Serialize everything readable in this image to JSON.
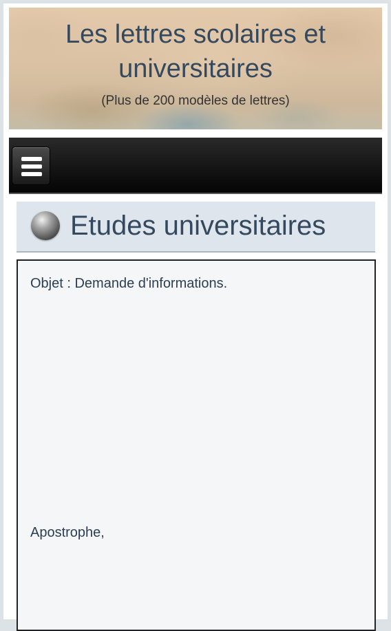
{
  "header": {
    "title": "Les lettres scolaires et universitaires",
    "subtitle": "(Plus de 200 modèles de lettres)"
  },
  "navbar": {
    "menu_icon": "hamburger-menu-icon"
  },
  "section": {
    "bullet_icon": "sphere-bullet-icon",
    "title": "Etudes universitaires"
  },
  "letter": {
    "object_line": "Objet : Demande d'informations.",
    "salutation": "Apostrophe,"
  },
  "colors": {
    "title_text": "#34495e",
    "navbar": "#151515",
    "section_header_bg": "#dfe5ec",
    "letter_bg": "#f4f6f8"
  }
}
